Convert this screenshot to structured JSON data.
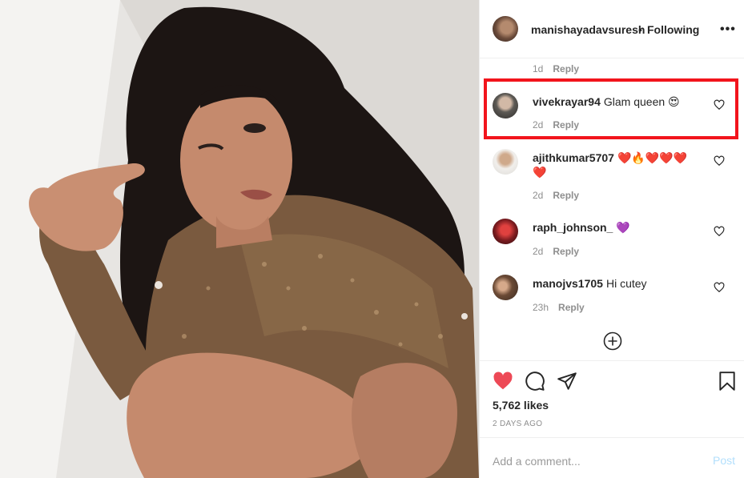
{
  "post": {
    "owner": "manishayadavsuresh",
    "separator": "•",
    "follow_status": "Following",
    "more_label": "•••",
    "likes_text": "5,762 likes",
    "date_text": "2 DAYS AGO"
  },
  "previous_comment": {
    "time": "1d",
    "reply_label": "Reply"
  },
  "comments": [
    {
      "user": "vivekrayar94",
      "text": "Glam queen 😍",
      "time": "2d",
      "reply_label": "Reply"
    },
    {
      "user": "ajithkumar5707",
      "text": "❤️🔥❤️❤️❤️ ❤️",
      "time": "2d",
      "reply_label": "Reply"
    },
    {
      "user": "raph_johnson_",
      "text": "💜",
      "time": "2d",
      "reply_label": "Reply"
    },
    {
      "user": "manojvs1705",
      "text": "Hi cutey",
      "time": "23h",
      "reply_label": "Reply"
    }
  ],
  "add_comment": {
    "placeholder": "Add a comment...",
    "post_label": "Post"
  },
  "icons": {
    "like": "heart-filled-icon",
    "comment": "comment-icon",
    "share": "paper-plane-icon",
    "save": "bookmark-icon",
    "load_more": "plus-circle-icon",
    "comment_like": "heart-outline-icon"
  },
  "colors": {
    "like_red": "#ed4956",
    "highlight_red": "#f2141c",
    "post_blue_disabled": "#b2dffc",
    "muted_gray": "#8e8e8e"
  }
}
